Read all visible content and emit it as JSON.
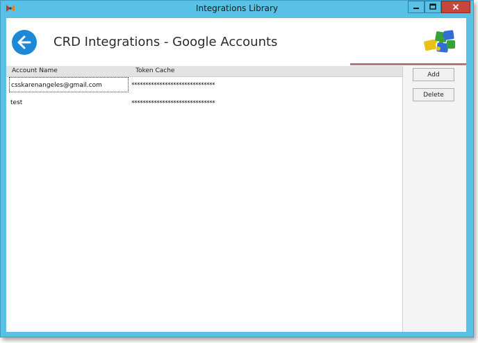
{
  "window": {
    "title": "Integrations Library"
  },
  "header": {
    "title": "CRD Integrations - Google Accounts"
  },
  "grid": {
    "columns": [
      "Account Name",
      "Token Cache"
    ],
    "rows": [
      {
        "account_name": "csskarenangeles@gmail.com",
        "token_cache": "******************************"
      },
      {
        "account_name": "test",
        "token_cache": "******************************"
      }
    ]
  },
  "actions": {
    "add_label": "Add",
    "delete_label": "Delete"
  },
  "colors": {
    "window_chrome": "#59c1e6",
    "close_button": "#c7463b",
    "back_button": "#1e88d8",
    "accent_line": "#c07070"
  },
  "icons": {
    "app": "app-icon",
    "back": "back-arrow-icon",
    "logo": "puzzle-pieces-icon",
    "minimize": "minimize-icon",
    "maximize": "maximize-icon",
    "close": "close-icon"
  }
}
